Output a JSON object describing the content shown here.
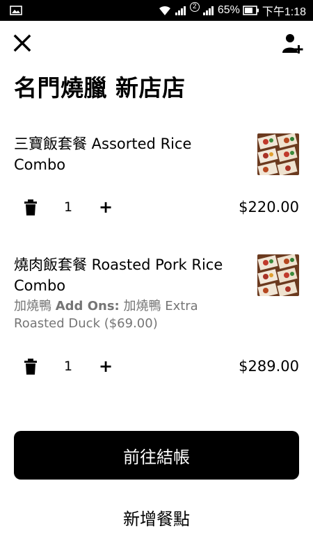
{
  "status_bar": {
    "battery_percent": "65%",
    "time": "下午1:18",
    "sim_badge": "2"
  },
  "header": {
    "close_icon": "close-icon",
    "add_person_icon": "add-person-icon"
  },
  "restaurant": {
    "name": "名門燒臘 新店店"
  },
  "cart": {
    "items": [
      {
        "name": "三寶飯套餐 Assorted Rice Combo",
        "addons_label": "",
        "addons_text": "",
        "quantity": "1",
        "price": "$220.00"
      },
      {
        "name": "燒肉飯套餐 Roasted Pork Rice Combo",
        "addons_prefix": "加燒鴨",
        "addons_label": "Add Ons:",
        "addons_text": "加燒鴨 Extra Roasted Duck ($69.00)",
        "quantity": "1",
        "price": "$289.00"
      }
    ]
  },
  "actions": {
    "checkout_label": "前往結帳",
    "add_items_label": "新增餐點"
  },
  "colors": {
    "primary": "#000000",
    "secondary_text": "#757575",
    "background": "#ffffff"
  }
}
